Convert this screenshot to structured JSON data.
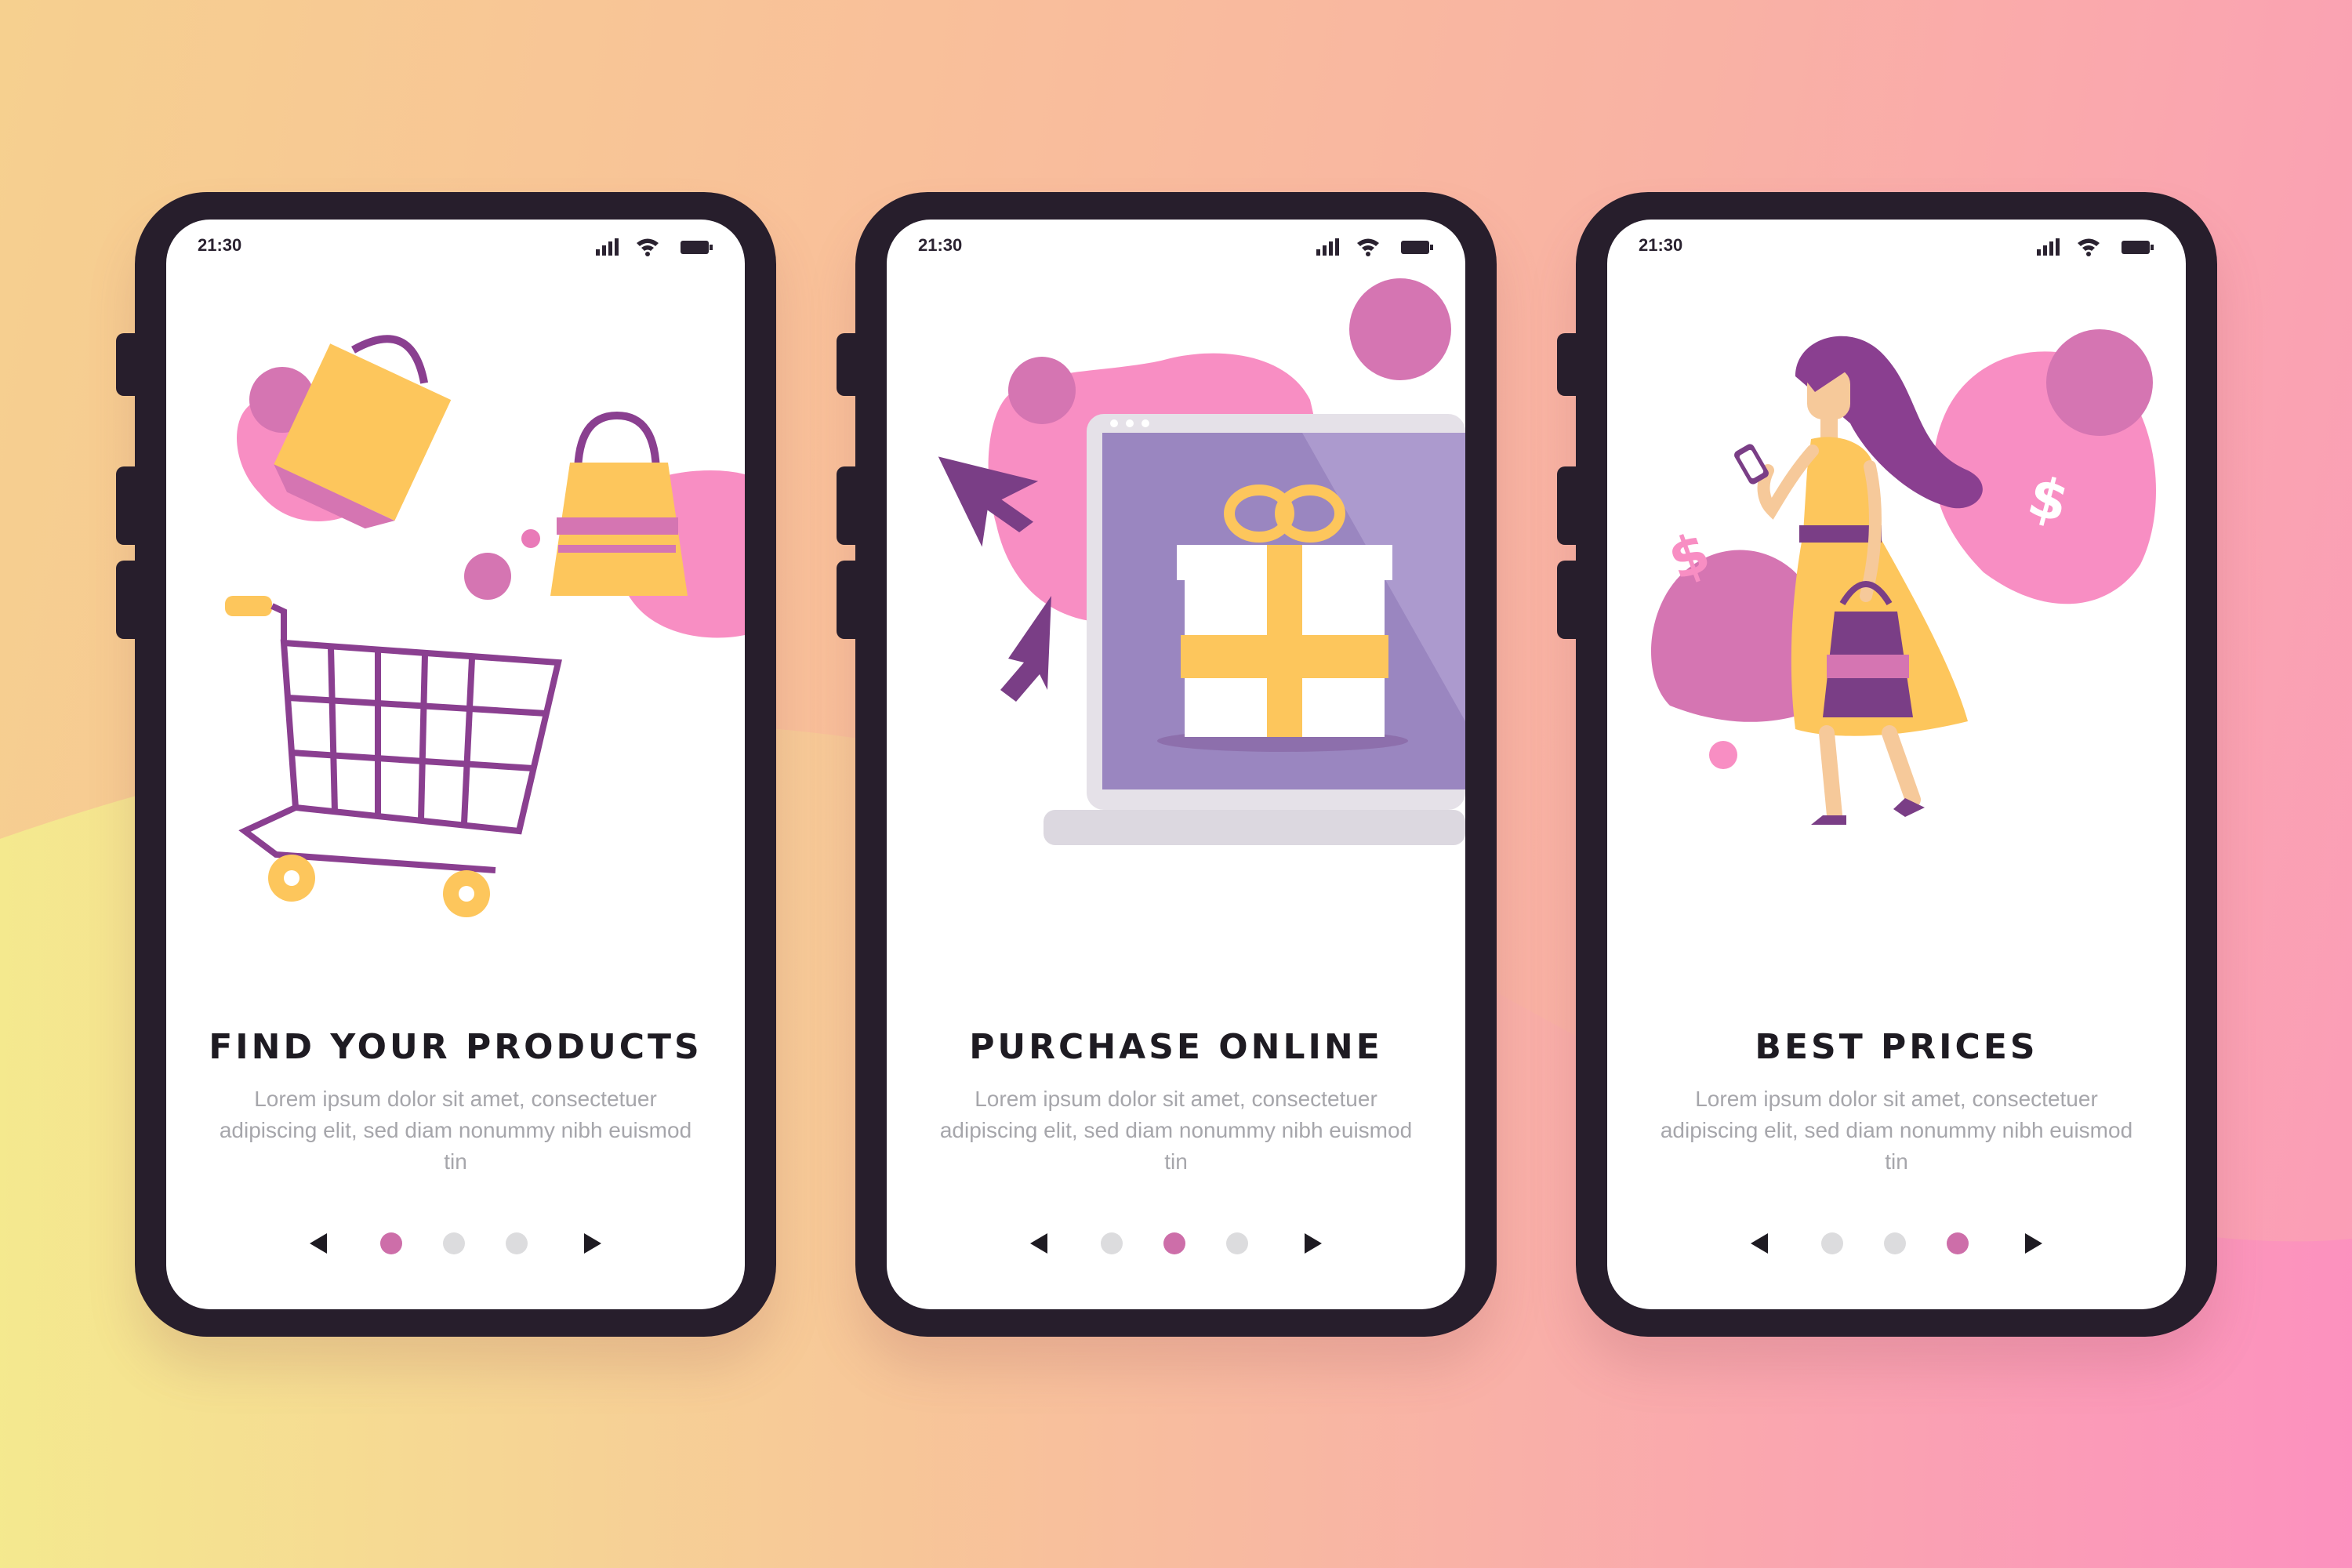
{
  "colors": {
    "frame": "#271e2c",
    "accent_pink": "#f58ac0",
    "accent_purple": "#7a3e86",
    "accent_yellow": "#fdc65c",
    "dot_active": "#cd6ea9",
    "dot_inactive": "#dcdcde"
  },
  "screens": [
    {
      "status_time": "21:30",
      "status_icons": [
        "signal-icon",
        "wifi-icon",
        "battery-icon"
      ],
      "illustration": "shopping-bags-and-cart",
      "title": "FIND YOUR PRODUCTS",
      "description": "Lorem ipsum dolor sit amet, consectetuer adipiscing elit, sed diam nonummy nibh euismod tin",
      "active_page": 1,
      "page_count": 3
    },
    {
      "status_time": "21:30",
      "status_icons": [
        "signal-icon",
        "wifi-icon",
        "battery-icon"
      ],
      "illustration": "laptop-with-gift",
      "title": "PURCHASE ONLINE",
      "description": "Lorem ipsum dolor sit amet, consectetuer adipiscing elit, sed diam nonummy nibh euismod tin",
      "active_page": 2,
      "page_count": 3
    },
    {
      "status_time": "21:30",
      "status_icons": [
        "signal-icon",
        "wifi-icon",
        "battery-icon"
      ],
      "illustration": "woman-shopping-with-phone",
      "title": "BEST PRICES",
      "description": "Lorem ipsum dolor sit amet, consectetuer adipiscing elit, sed diam nonummy nibh euismod tin",
      "active_page": 3,
      "page_count": 3
    }
  ]
}
